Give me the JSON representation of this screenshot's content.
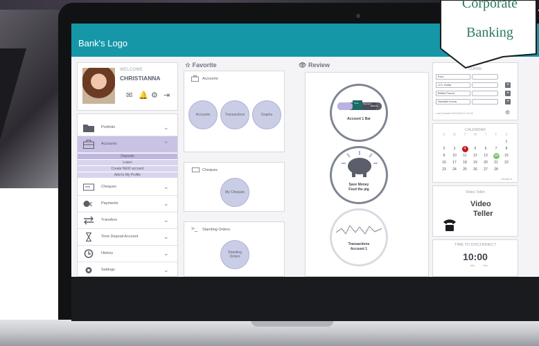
{
  "app": {
    "logo_text": "Bank's Logo"
  },
  "badge": {
    "line1": "Corporate",
    "line2": "Banking",
    "color": "#2c7a5b"
  },
  "profile": {
    "welcome_label": "WELCOME",
    "user_name": "CHRISTIANNA",
    "icons": [
      "mail-icon",
      "bell-icon",
      "gear-icon",
      "logout-icon"
    ]
  },
  "menu": {
    "items": [
      {
        "label": "Portfolio",
        "icon": "folder-icon"
      },
      {
        "label": "Accounts",
        "icon": "briefcase-icon",
        "active": true
      },
      {
        "label": "Cheques",
        "icon": "cheque-icon"
      },
      {
        "label": "Payments",
        "icon": "payments-icon"
      },
      {
        "label": "Transfers",
        "icon": "transfer-icon"
      },
      {
        "label": "Time Deposit Account",
        "icon": "hourglass-icon"
      },
      {
        "label": "History",
        "icon": "history-icon"
      },
      {
        "label": "Settings",
        "icon": "gear-icon"
      }
    ],
    "submenu": [
      "Deposits",
      "Loans",
      "Create NEW account",
      "Add to My Profile"
    ]
  },
  "favorite": {
    "title": "Favorite",
    "cards": [
      {
        "heading": "Accounts",
        "bubbles": [
          "Accounts",
          "Transactions",
          "Graphs"
        ]
      },
      {
        "heading": "Cheques",
        "bubbles": [
          "My Cheques"
        ]
      },
      {
        "heading": "Standing Orders",
        "bubbles": [
          "Standing Orders"
        ]
      }
    ]
  },
  "review": {
    "title": "Review",
    "widgets": [
      {
        "label": "Account 1 Bar",
        "bar_labels": [
          "Time",
          "Payment",
          "Balance"
        ]
      },
      {
        "label_line1": "Save Money",
        "label_line2": "Feed the pig"
      },
      {
        "label_line1": "Transactions",
        "label_line2": "Account 1"
      }
    ]
  },
  "currency": {
    "title": "CURRE",
    "rows": [
      "Euro",
      "U.S. Dollar",
      "British Pound",
      "Swedish Krona"
    ],
    "last_update": "Last Update:02/09/2013 12:00"
  },
  "calendar": {
    "title": "CALENDAR",
    "weekdays": [
      "S",
      "M",
      "T",
      "W",
      "T",
      "F",
      "S"
    ],
    "rows": [
      [
        "",
        "",
        "",
        "",
        "",
        "",
        "1"
      ],
      [
        "2",
        "3",
        "4",
        "5",
        "6",
        "7",
        "8"
      ],
      [
        "9",
        "10",
        "11",
        "12",
        "13",
        "14",
        "15"
      ],
      [
        "16",
        "17",
        "18",
        "19",
        "20",
        "21",
        "22"
      ],
      [
        "23",
        "24",
        "25",
        "26",
        "27",
        "28",
        ""
      ]
    ],
    "today": "4",
    "marked": "14",
    "details_link": "Details"
  },
  "video_teller": {
    "title": "Video Teller",
    "heading_line1": "Video",
    "heading_line2": "Teller"
  },
  "disconnect": {
    "title": "TIME TO DISCONNECT",
    "time": "10:00",
    "unit_min": "Min",
    "unit_sec": "Sec"
  }
}
